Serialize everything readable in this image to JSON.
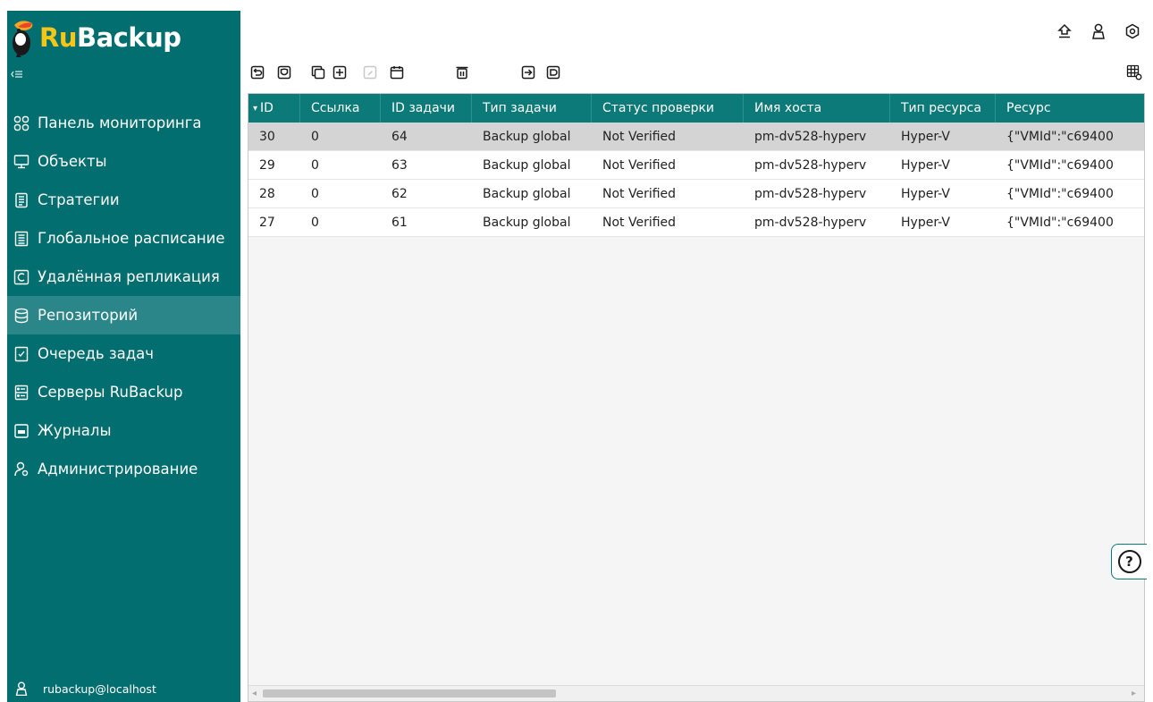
{
  "app": {
    "logo_ru": "Ru",
    "logo_backup": "Backup"
  },
  "sidebar": {
    "collapse_icon": "collapse-left-icon",
    "items": [
      {
        "label": "Панель мониторинга",
        "icon": "dashboard-icon"
      },
      {
        "label": "Объекты",
        "icon": "monitor-icon"
      },
      {
        "label": "Стратегии",
        "icon": "strategy-icon"
      },
      {
        "label": "Глобальное расписание",
        "icon": "schedule-icon"
      },
      {
        "label": "Удалённая репликация",
        "icon": "replication-icon"
      },
      {
        "label": "Репозиторий",
        "icon": "database-icon",
        "active": true
      },
      {
        "label": "Очередь задач",
        "icon": "task-queue-icon"
      },
      {
        "label": "Серверы RuBackup",
        "icon": "server-icon"
      },
      {
        "label": "Журналы",
        "icon": "log-icon"
      },
      {
        "label": "Администрирование",
        "icon": "admin-icon"
      }
    ],
    "user": "rubackup@localhost"
  },
  "header": {
    "icons": [
      "upload-icon",
      "user-icon",
      "settings-icon"
    ]
  },
  "toolbar": {
    "icons": [
      "restore-icon",
      "verify-icon",
      "copy-icon",
      "move-icon",
      "edit-icon",
      "calendar-icon",
      "delete-icon",
      "export-icon",
      "import-icon",
      "table-settings-icon"
    ]
  },
  "table": {
    "sort_indicator": "▾",
    "columns": [
      "ID",
      "Ссылка",
      "ID задачи",
      "Тип задачи",
      "Статус проверки",
      "Имя хоста",
      "Тип ресурса",
      "Ресурс"
    ],
    "rows": [
      [
        "30",
        "0",
        "64",
        "Backup global",
        "Not Verified",
        "pm-dv528-hyperv",
        "Hyper-V",
        "{\"VMId\":\"c69400"
      ],
      [
        "29",
        "0",
        "63",
        "Backup global",
        "Not Verified",
        "pm-dv528-hyperv",
        "Hyper-V",
        "{\"VMId\":\"c69400"
      ],
      [
        "28",
        "0",
        "62",
        "Backup global",
        "Not Verified",
        "pm-dv528-hyperv",
        "Hyper-V",
        "{\"VMId\":\"c69400"
      ],
      [
        "27",
        "0",
        "61",
        "Backup global",
        "Not Verified",
        "pm-dv528-hyperv",
        "Hyper-V",
        "{\"VMId\":\"c69400"
      ]
    ],
    "selected_row": 0
  },
  "help": {
    "label": "?"
  },
  "colors": {
    "sidebar_bg": "#036e70",
    "sidebar_active": "#2a8688",
    "header_bg": "#0c7a79",
    "logo_ru": "#f5c518"
  }
}
